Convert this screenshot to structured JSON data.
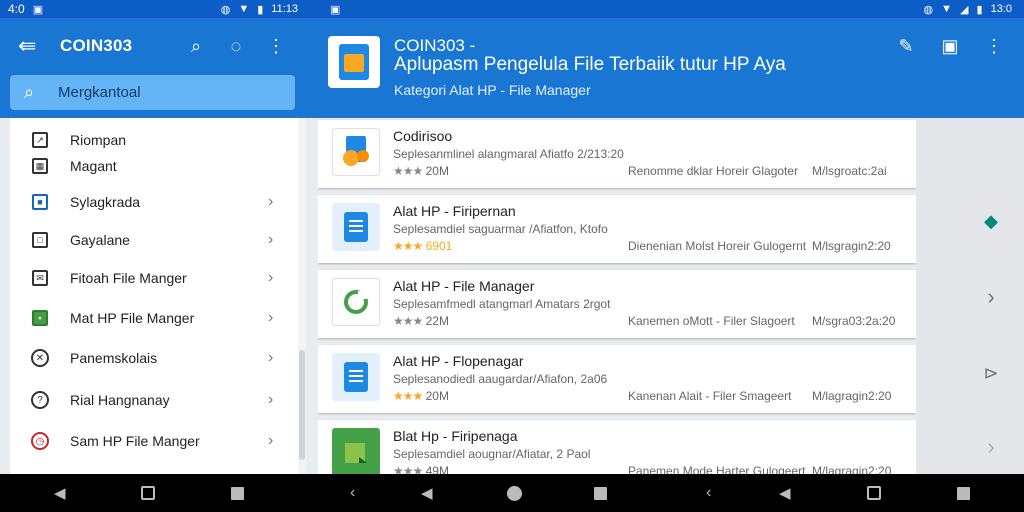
{
  "status_left": {
    "time": "4:0",
    "clock": "11:13"
  },
  "status_right": {
    "time": "13:0"
  },
  "left": {
    "title": "COIN303",
    "search_placeholder": "Mergkantoal",
    "drawer_items": [
      {
        "label": "Riompan",
        "icon": "export-icon",
        "chevron": false
      },
      {
        "label": "Magant",
        "icon": "grid-icon",
        "chevron": false
      },
      {
        "label": "Sylagkrada",
        "icon": "square-icon",
        "chevron": true
      },
      {
        "label": "Gayalane",
        "icon": "square-outline-icon",
        "chevron": true
      },
      {
        "label": "Fitoah File Manger",
        "icon": "mail-icon",
        "chevron": true
      },
      {
        "label": "Mat HP File Manger",
        "icon": "folder-icon",
        "chevron": true
      },
      {
        "label": "Panemskolais",
        "icon": "close-circle-icon",
        "chevron": true
      },
      {
        "label": "Rial Hangnanay",
        "icon": "help-icon",
        "chevron": true
      },
      {
        "label": "Sam HP File Manger",
        "icon": "clock-icon",
        "chevron": true
      }
    ]
  },
  "right": {
    "title_line1": "COIN303 -",
    "title_line2": "Aplupasm Pengelula File Terbaiik tutur HP Aya",
    "subtitle": "Kategori Alat HP - File Manager",
    "apps": [
      {
        "name": "Codirisoo",
        "desc": "Seplesanmlinel alangmaral Afiatfo 2/213:20",
        "rating": "20M",
        "gold": false,
        "meta": "Renomme dklar Horeir Glagoter",
        "meta_color": "green",
        "size": "M/lsgroatc:2ai",
        "thumb": "#ffffff"
      },
      {
        "name": "Alat HP - Firipernan",
        "desc": "Seplesamdiel saguarmar /Afiatfon, Ktofo",
        "rating": "6901",
        "gold": true,
        "meta": "Dienenian Molst Horeir Gulogernt",
        "meta_color": "mixed",
        "size": "M/lsgragin2:20",
        "thumb": "#e3f0fc"
      },
      {
        "name": "Alat HP - File Manager",
        "desc": "Seplesamfmedl atangmarl Amatars 2rgot",
        "rating": "22M",
        "gold": false,
        "meta": "Kanemen oMott - Filer Slagoert",
        "meta_color": "blue",
        "size": "M/sgra03:2a:20",
        "thumb": "#ffffff"
      },
      {
        "name": "Alat HP - Flopenagar",
        "desc": "Seplesanodiedl aaugardar/Afiafon, 2a06",
        "rating": "20M",
        "gold": true,
        "meta": "Kanenan Alait - Filer Smageert",
        "meta_color": "blue",
        "size": "M/lagragin2:20",
        "thumb": "#e3f0fc"
      },
      {
        "name": "Blat Hp - Firipenaga",
        "desc": "Seplesamdiel aougnar/Afiatar, 2 Paol",
        "rating": "49M",
        "gold": false,
        "meta": "Panemen Mode Harter Gulogeert",
        "meta_color": "gray",
        "size": "M/lagragin2:20",
        "thumb": "#43a047"
      }
    ]
  },
  "colors": {
    "appbar": "#1976d2",
    "status": "#0c5dc6",
    "search": "#64b5f6"
  }
}
